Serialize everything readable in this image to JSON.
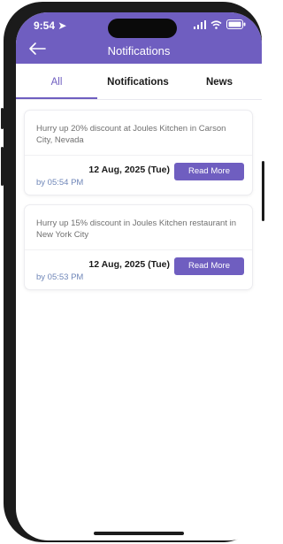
{
  "status": {
    "time": "9:54"
  },
  "header": {
    "title": "Notifications"
  },
  "tabs": [
    {
      "label": "All",
      "active": true
    },
    {
      "label": "Notifications",
      "active": false
    },
    {
      "label": "News",
      "active": false
    }
  ],
  "notifications": [
    {
      "text": "Hurry up 20% discount at Joules Kitchen in Carson City, Nevada",
      "date": "12 Aug, 2025 (Tue)",
      "by": "by 05:54 PM",
      "button": "Read More"
    },
    {
      "text": "Hurry up 15% discount in Joules Kitchen restaurant in New York City",
      "date": "12 Aug, 2025 (Tue)",
      "by": "by 05:53 PM",
      "button": "Read More"
    }
  ],
  "colors": {
    "accent": "#6f5ec0",
    "meta_text": "#6f86b8"
  }
}
